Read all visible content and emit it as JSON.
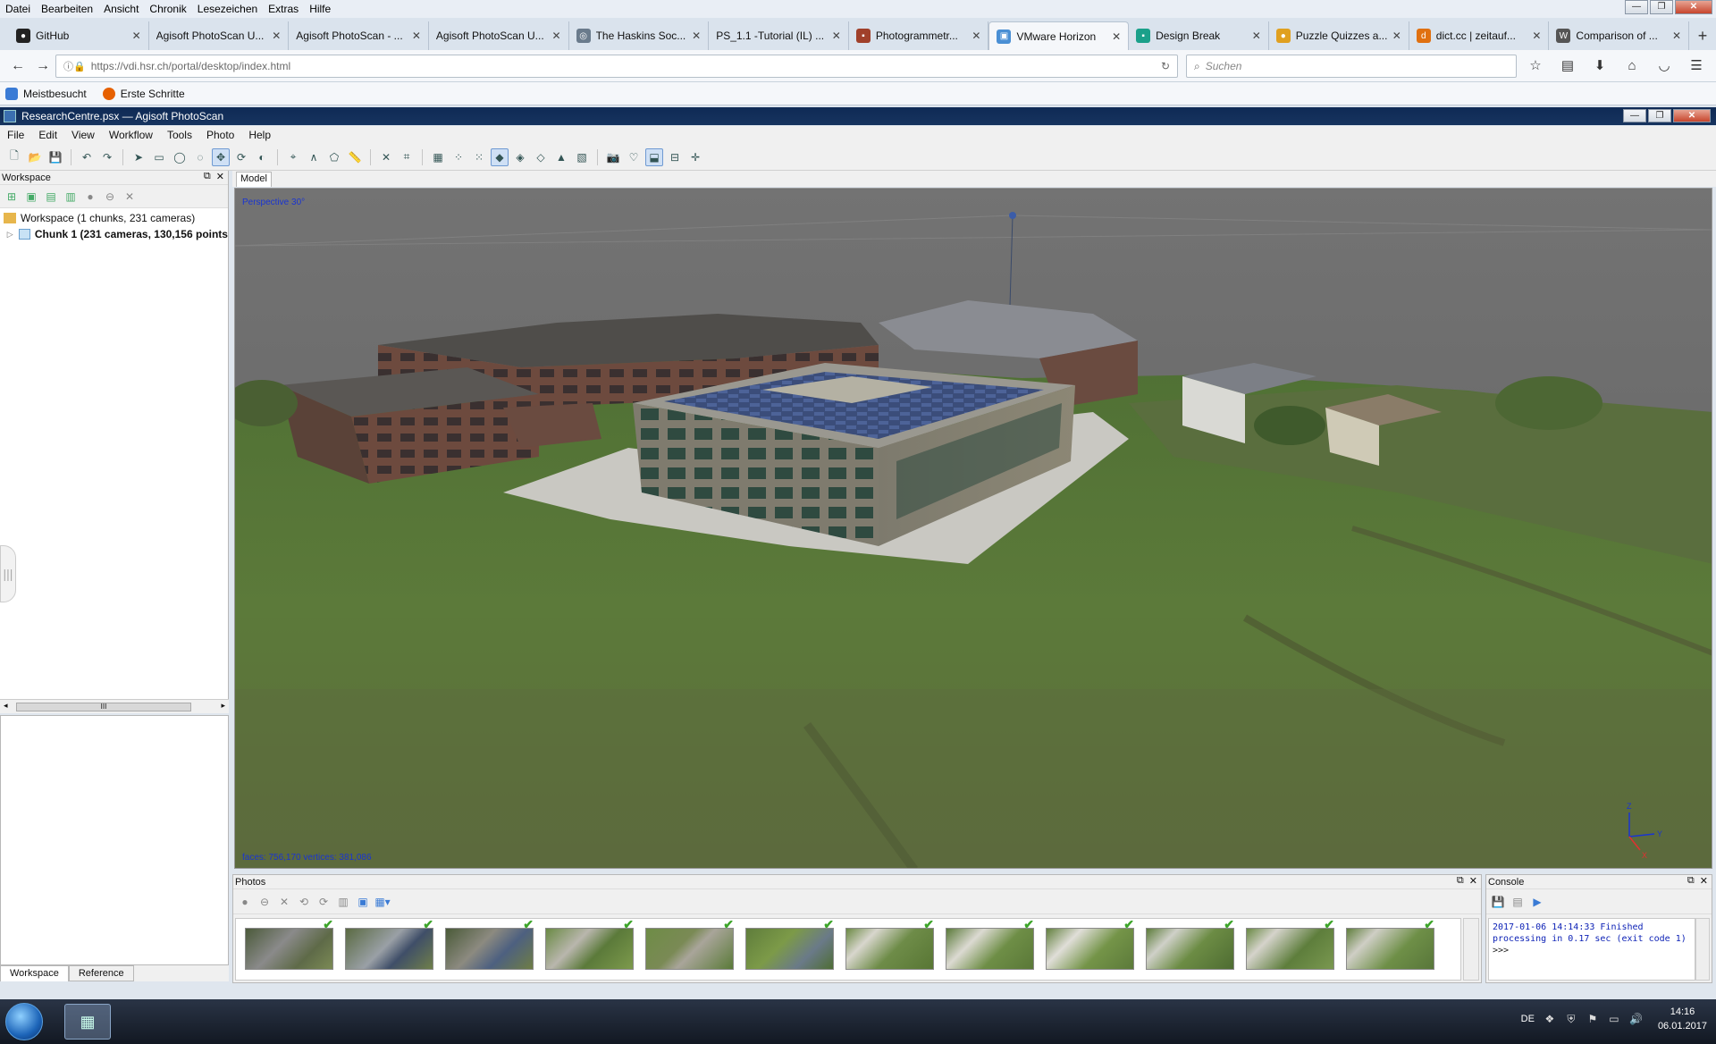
{
  "browser": {
    "menu": [
      "Datei",
      "Bearbeiten",
      "Ansicht",
      "Chronik",
      "Lesezeichen",
      "Extras",
      "Hilfe"
    ],
    "tabs": [
      {
        "label": "GitHub",
        "icon": "github-icon",
        "color": "#222222"
      },
      {
        "label": "Agisoft PhotoScan U...",
        "icon": "",
        "color": ""
      },
      {
        "label": "Agisoft PhotoScan - ...",
        "icon": "",
        "color": ""
      },
      {
        "label": "Agisoft PhotoScan U...",
        "icon": "",
        "color": ""
      },
      {
        "label": "The Haskins Soc...",
        "icon": "globe-icon",
        "color": "#6a7b8c"
      },
      {
        "label": "PS_1.1 -Tutorial (IL) ...",
        "icon": "",
        "color": ""
      },
      {
        "label": "Photogrammetr...",
        "icon": "page-icon",
        "color": "#a0402a"
      },
      {
        "label": "VMware Horizon",
        "icon": "vmware-icon",
        "color": "#4a8fd4"
      },
      {
        "label": "Design Break",
        "icon": "design-icon",
        "color": "#1aa08a"
      },
      {
        "label": "Puzzle Quizzes a...",
        "icon": "bulb-icon",
        "color": "#e0a020"
      },
      {
        "label": "dict.cc | zeitauf...",
        "icon": "dict-icon",
        "color": "#e07010"
      },
      {
        "label": "Comparison of ...",
        "icon": "wikipedia-icon",
        "color": "#555555"
      }
    ],
    "active_tab": 7,
    "url": "https://vdi.hsr.ch/portal/desktop/index.html",
    "search_placeholder": "Suchen",
    "bookmarks": [
      {
        "label": "Meistbesucht",
        "color": "#3a7bd5"
      },
      {
        "label": "Erste Schritte",
        "color": "#e66000"
      }
    ]
  },
  "app": {
    "title": "ResearchCentre.psx — Agisoft PhotoScan",
    "menu": [
      "File",
      "Edit",
      "View",
      "Workflow",
      "Tools",
      "Photo",
      "Help"
    ],
    "workspace": {
      "header": "Workspace",
      "root": "Workspace (1 chunks, 231 cameras)",
      "chunk": "Chunk 1 (231 cameras, 130,156 points"
    },
    "bottom_tabs": [
      "Workspace",
      "Reference"
    ],
    "model": {
      "tab": "Model",
      "projection": "Perspective 30°",
      "stats": "faces: 756,170 vertices: 381,086",
      "axis_labels": {
        "z": "Z",
        "y": "Y",
        "x": "X"
      }
    },
    "photos": {
      "header": "Photos",
      "count": 12
    },
    "console": {
      "header": "Console",
      "output": "2017-01-06 14:14:33 Finished processing in 0.17 sec (exit code 1)",
      "prompt": ">>>"
    }
  },
  "taskbar": {
    "lang": "DE",
    "time": "14:16",
    "date": "06.01.2017"
  },
  "colors": {
    "titlebar": "#0f2a55",
    "sky": "#6b6b6b",
    "grass": "#5a7a38",
    "check": "#3da52a",
    "console_text": "#0a1fb5"
  }
}
